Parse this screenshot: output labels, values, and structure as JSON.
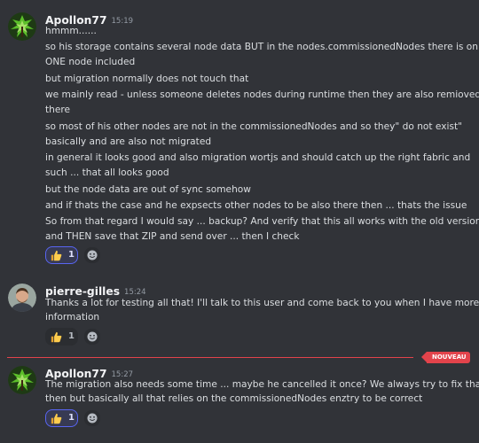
{
  "messages": [
    {
      "author": "Apollon77",
      "time": "15:19",
      "avatar": "tree-avatar",
      "lines": [
        "hmmm......",
        "so his storage contains several node data BUT in the nodes.commissionedNodes there is only",
        "ONE node included",
        "but migration normally does not touch that",
        "we mainly read - unless someone deletes nodes during runtime then they are also remioved",
        "there",
        "so most of his other nodes are not in the commissionedNodes and so they\" do not exist\"",
        "basically and are also not migrated",
        "in general it looks good  and also migration wortjs and should catch up the right fabric and",
        "such ... that all looks good",
        "but the node data are out of sync somehow",
        "and if thats the case and he expsects other nodes to be also there then ... thats the issue",
        "So from that regard I would say ... backup? And verify that this all works with the old version",
        "and THEN save that ZIP and send over ... then I check"
      ],
      "reaction": {
        "emoji": "thumbs-up-icon",
        "count": "1"
      }
    },
    {
      "author": "pierre-gilles",
      "time": "15:24",
      "avatar": "person-avatar",
      "lines": [
        "Thanks a lot for testing all that! I'll talk to this user and come back to you when I have more",
        "information"
      ],
      "reaction": {
        "emoji": "thumbs-up-icon",
        "count": "1"
      }
    },
    {
      "author": "Apollon77",
      "time": "15:27",
      "avatar": "tree-avatar",
      "lines": [
        "The migration also needs some time ... maybe he cancelled it once? We always try to fix that",
        "then but basically all that relies on the commissionedNodes enztry to be correct"
      ],
      "reaction": {
        "emoji": "thumbs-up-icon",
        "count": "1"
      }
    }
  ],
  "new_divider": {
    "label": "NOUVEAU",
    "color": "#e2434b"
  },
  "colors": {
    "background": "#313338",
    "accent": "#5865f2",
    "text": "#dbdee1"
  }
}
